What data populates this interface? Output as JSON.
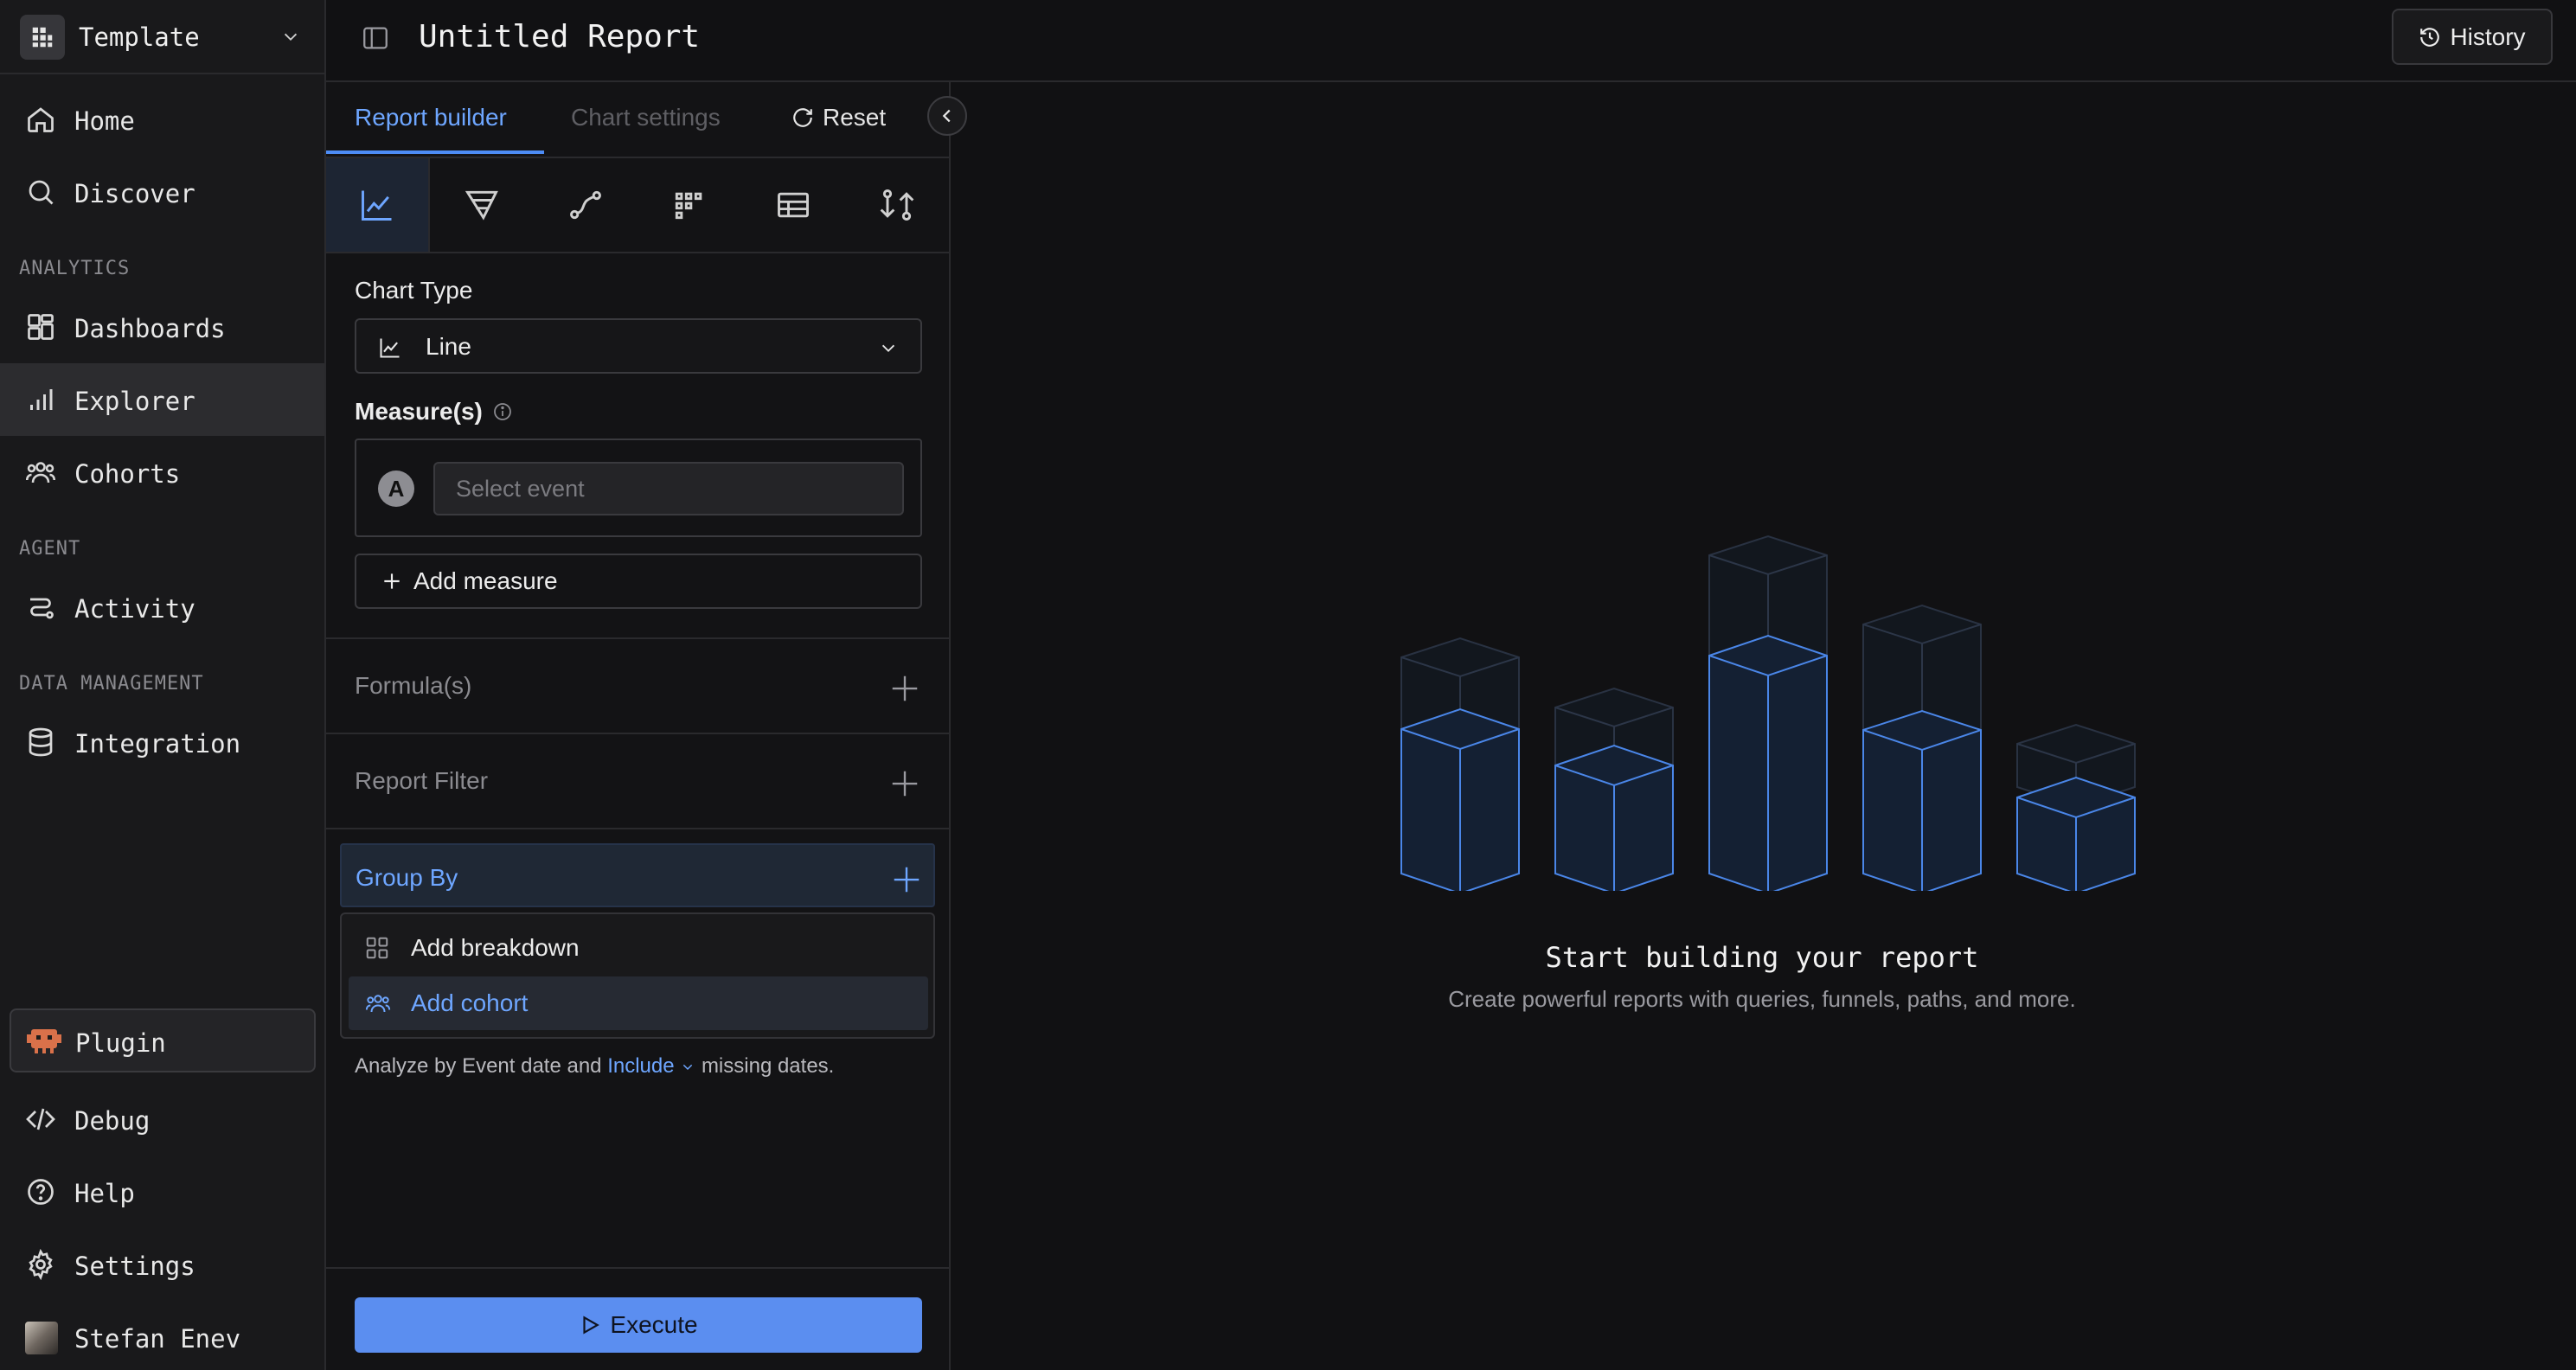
{
  "workspace": {
    "name": "Template"
  },
  "nav": {
    "home": "Home",
    "discover": "Discover",
    "sections": {
      "analytics": "ANALYTICS",
      "agent": "AGENT",
      "data": "DATA MANAGEMENT"
    },
    "dashboards": "Dashboards",
    "explorer": "Explorer",
    "cohorts": "Cohorts",
    "activity": "Activity",
    "integration": "Integration",
    "plugin": "Plugin",
    "debug": "Debug",
    "help": "Help",
    "settings": "Settings",
    "user": "Stefan Enev"
  },
  "header": {
    "title": "Untitled Report",
    "history_label": "History"
  },
  "builder": {
    "tabs": {
      "report_builder": "Report builder",
      "chart_settings": "Chart settings"
    },
    "reset_label": "Reset",
    "chart_type_label": "Chart Type",
    "chart_type_value": "Line",
    "measures_label": "Measure(s)",
    "measure_letter": "A",
    "event_placeholder": "Select event",
    "add_measure_label": "Add measure",
    "formulas_label": "Formula(s)",
    "report_filter_label": "Report Filter",
    "group_by_label": "Group By",
    "group_by_menu": {
      "add_breakdown": "Add breakdown",
      "add_cohort": "Add cohort"
    },
    "analyze": {
      "prefix": "Analyze by Event  date and",
      "include": "Include",
      "suffix": "missing dates."
    },
    "execute_label": "Execute"
  },
  "empty_state": {
    "title": "Start building your report",
    "subtitle": "Create powerful reports with queries, funnels, paths, and more."
  },
  "colors": {
    "accent": "#4d8cf5",
    "accent_text": "#6ea6ff",
    "background": "#111113",
    "execute": "#5b8ef0"
  },
  "icons": [
    "grid-icon",
    "chevron-down-icon",
    "home-icon",
    "search-icon",
    "dashboards-icon",
    "bar-chart-icon",
    "users-icon",
    "activity-icon",
    "database-icon",
    "plugin-icon",
    "code-icon",
    "help-icon",
    "gear-icon",
    "sidebar-toggle-icon",
    "history-icon",
    "reset-icon",
    "chevron-left-icon",
    "line-chart-icon",
    "funnel-icon",
    "path-icon",
    "retention-icon",
    "table-icon",
    "flow-icon",
    "info-icon",
    "plus-icon",
    "play-icon"
  ]
}
